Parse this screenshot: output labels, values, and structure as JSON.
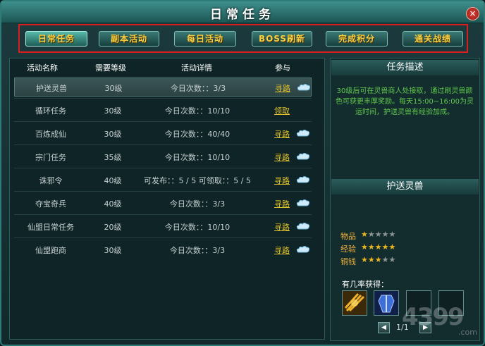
{
  "window": {
    "title": "日常任务",
    "close_label": "×"
  },
  "tabs": [
    "日常任务",
    "副本活动",
    "每日活动",
    "BOSS刷新",
    "完成积分",
    "通关战绩"
  ],
  "table": {
    "headers": [
      "活动名称",
      "需要等级",
      "活动详情",
      "参与"
    ],
    "rows": [
      {
        "name": "护送灵兽",
        "level": "30级",
        "detail": "今日次数：：3/3",
        "action": "寻路",
        "cloud": true
      },
      {
        "name": "循环任务",
        "level": "30级",
        "detail": "今日次数：：10/10",
        "action": "领取",
        "cloud": false
      },
      {
        "name": "百炼成仙",
        "level": "30级",
        "detail": "今日次数：：40/40",
        "action": "寻路",
        "cloud": true
      },
      {
        "name": "宗门任务",
        "level": "35级",
        "detail": "今日次数：：10/10",
        "action": "寻路",
        "cloud": true
      },
      {
        "name": "诛邪令",
        "level": "40级",
        "detail": "可发布：：5 / 5   可领取：：5 / 5",
        "action": "寻路",
        "cloud": true
      },
      {
        "name": "夺宝奇兵",
        "level": "40级",
        "detail": "今日次数：：3/3",
        "action": "寻路",
        "cloud": true
      },
      {
        "name": "仙盟日常任务",
        "level": "20级",
        "detail": "今日次数：：10/10",
        "action": "寻路",
        "cloud": true
      },
      {
        "name": "仙盟跑商",
        "level": "30级",
        "detail": "今日次数：：3/3",
        "action": "寻路",
        "cloud": true
      }
    ]
  },
  "side": {
    "desc_title": "任务描述",
    "desc_text": "30级后可在灵兽商人处接取，通过刷灵兽颜色可获更丰厚奖励。每天15:00~16:00为灵运时间，护送灵兽有经验加成。",
    "task_title": "护送灵兽",
    "ratings": [
      {
        "label": "物品",
        "stars": 1
      },
      {
        "label": "经验",
        "stars": 5
      },
      {
        "label": "铜钱",
        "stars": 3
      }
    ],
    "loot_label": "有几率获得：",
    "pager": "1/1"
  },
  "watermark": {
    "main": "4399",
    "sub": ".com"
  },
  "colors": {
    "accent": "#f4d245",
    "link": "#e2c32b",
    "desc": "#60c94c"
  }
}
